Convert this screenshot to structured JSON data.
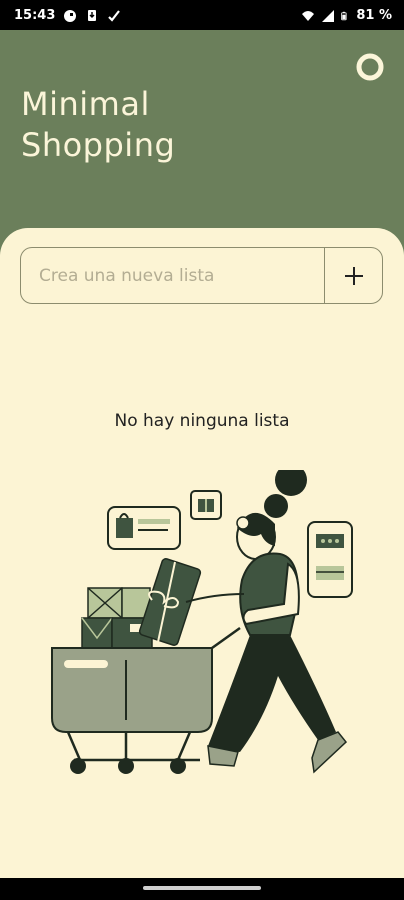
{
  "status_bar": {
    "time": "15:43",
    "battery": "81 %",
    "icons_left": [
      "google-icon",
      "download-icon",
      "check-icon"
    ],
    "icons_right": [
      "wifi-icon",
      "signal-icon",
      "battery-icon"
    ]
  },
  "header": {
    "title_line1": "Minimal",
    "title_line2": "Shopping",
    "settings_icon": "settings-ring-icon"
  },
  "new_list": {
    "placeholder": "Crea una nueva lista",
    "add_icon": "plus-icon"
  },
  "empty_state": {
    "message": "No hay ninguna lista"
  },
  "colors": {
    "header_bg": "#6b7f5b",
    "content_bg": "#fcf4d4",
    "title_text": "#fbf5d9",
    "border": "#8c8c6e",
    "illustration_dark": "#1f2a1f",
    "illustration_green": "#3f5440",
    "illustration_light_green": "#b8c69a"
  }
}
